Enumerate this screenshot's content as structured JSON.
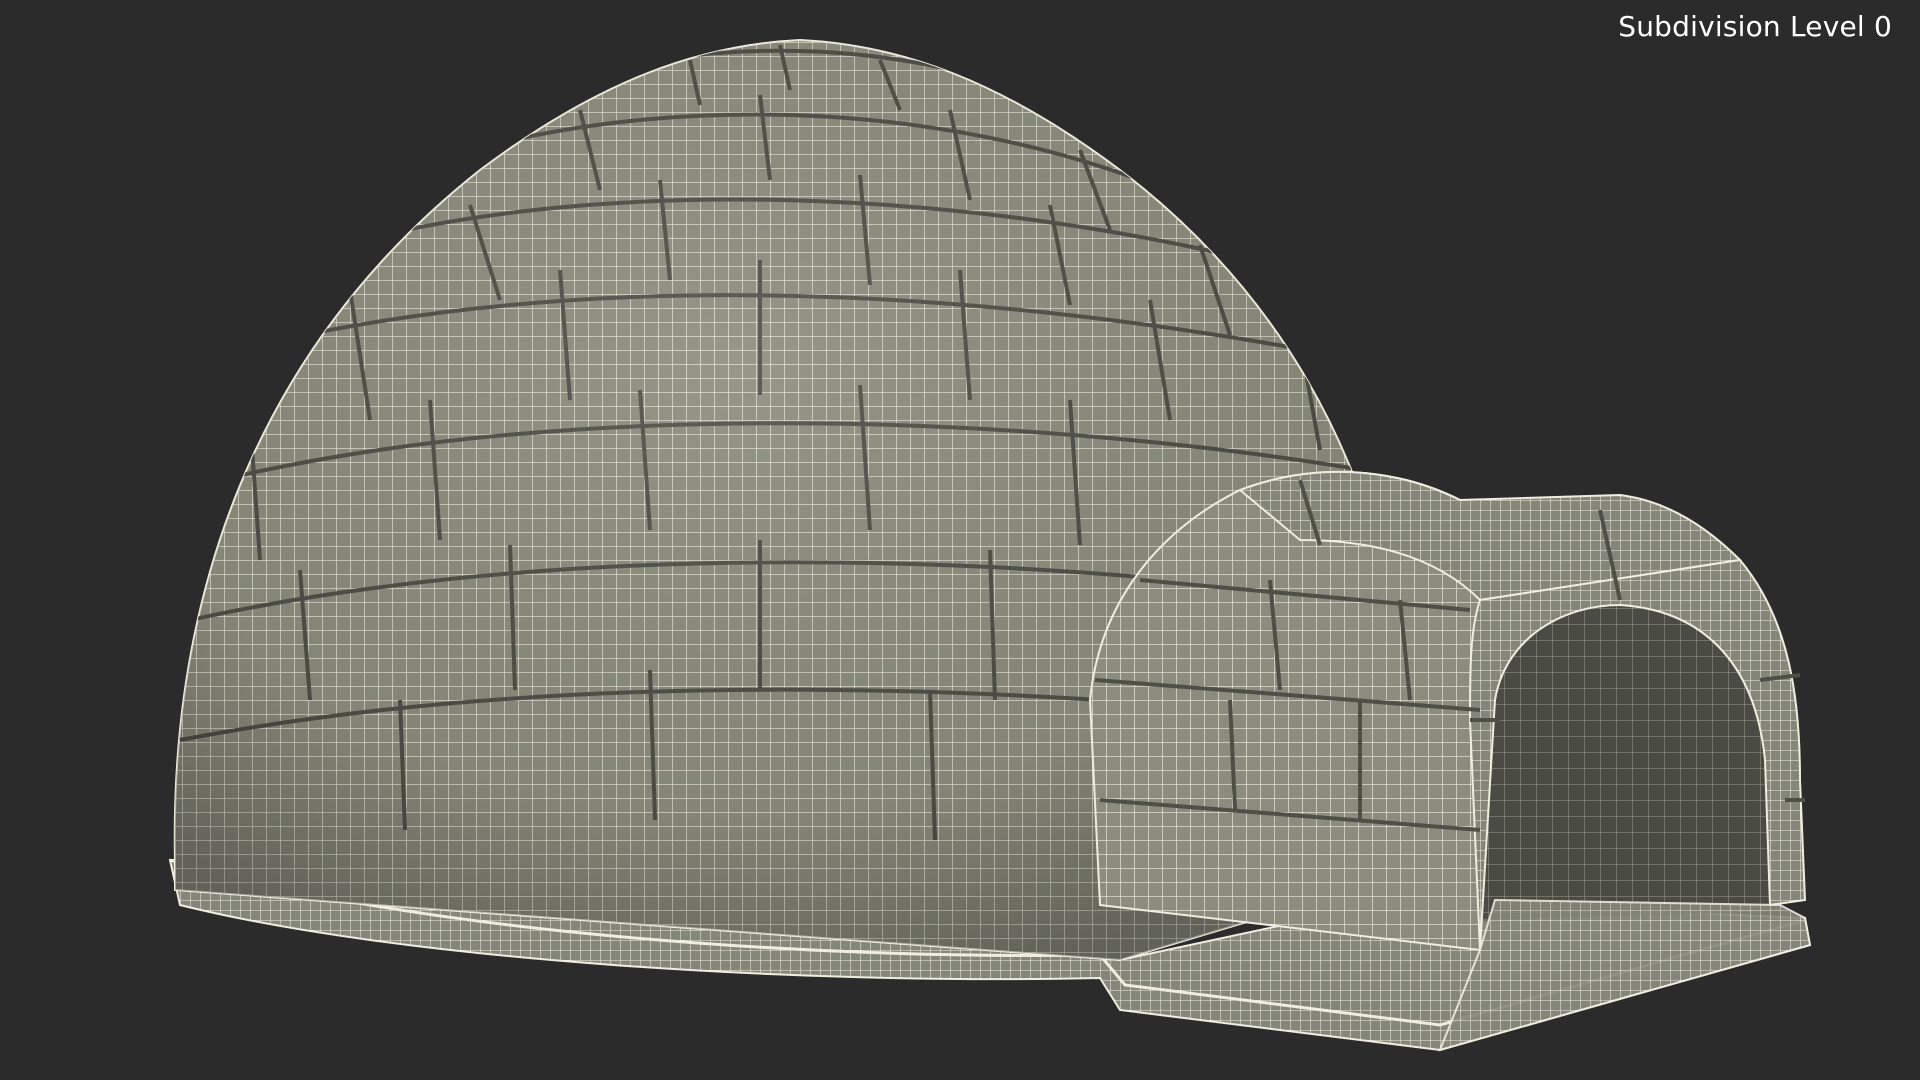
{
  "viewport": {
    "overlay_label": "Subdivision Level 0"
  },
  "scene": {
    "subject": "igloo-wireframe-model",
    "colors": {
      "background": "#2b2b2b",
      "surface": "#8b8c7d",
      "surface_dark": "#5c5d53",
      "interior": "#3a3b36",
      "wire": "#f2f1e6",
      "seam": "#4e4f47"
    }
  }
}
